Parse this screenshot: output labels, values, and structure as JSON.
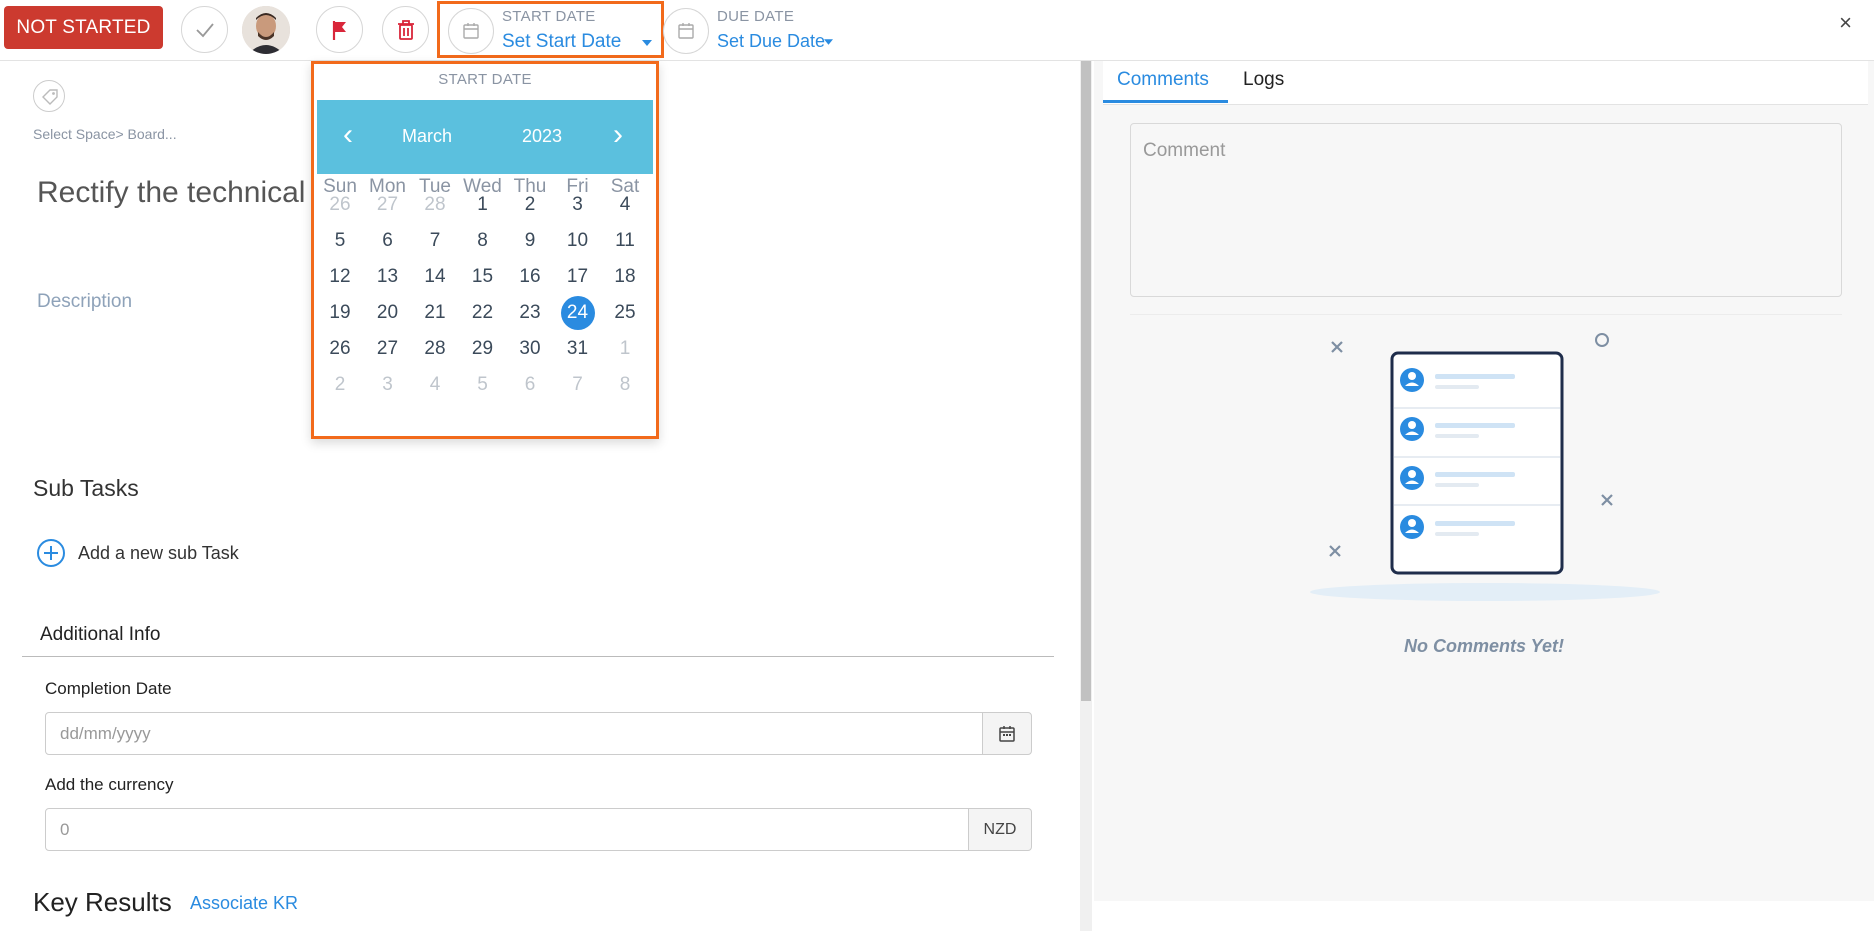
{
  "topbar": {
    "status_label": "NOT STARTED",
    "start_date": {
      "label": "START DATE",
      "value": "Set Start Date"
    },
    "due_date": {
      "label": "DUE DATE",
      "value": "Set Due Date"
    },
    "close_label": "×"
  },
  "left": {
    "breadcrumb": "Select Space> Board...",
    "task_title": "Rectify the technical s",
    "description_label": "Description",
    "subtasks_label": "Sub Tasks",
    "add_subtask_label": "Add a new sub Task",
    "additional_info_label": "Additional Info",
    "completion_date_label": "Completion Date",
    "completion_date_placeholder": "dd/mm/yyyy",
    "currency_label": "Add the currency",
    "currency_placeholder": "0",
    "currency_code": "NZD",
    "key_results_label": "Key Results",
    "associate_kr_label": "Associate KR"
  },
  "right": {
    "tabs": [
      {
        "label": "Comments"
      },
      {
        "label": "Logs"
      }
    ],
    "comment_placeholder": "Comment",
    "empty_message": "No Comments Yet!"
  },
  "calendar": {
    "title": "START DATE",
    "month": "March",
    "year": "2023",
    "prev": "‹",
    "next": "›",
    "weekdays": [
      "Sun",
      "Mon",
      "Tue",
      "Wed",
      "Thu",
      "Fri",
      "Sat"
    ],
    "weeks": [
      [
        "26",
        "27",
        "28",
        "1",
        "2",
        "3",
        "4"
      ],
      [
        "5",
        "6",
        "7",
        "8",
        "9",
        "10",
        "11"
      ],
      [
        "12",
        "13",
        "14",
        "15",
        "16",
        "17",
        "18"
      ],
      [
        "19",
        "20",
        "21",
        "22",
        "23",
        "24",
        "25"
      ],
      [
        "26",
        "27",
        "28",
        "29",
        "30",
        "31",
        "1"
      ],
      [
        "2",
        "3",
        "4",
        "5",
        "6",
        "7",
        "8"
      ]
    ],
    "muted_days": [
      [
        0,
        0
      ],
      [
        0,
        1
      ],
      [
        0,
        2
      ],
      [
        4,
        6
      ],
      [
        5,
        0
      ],
      [
        5,
        1
      ],
      [
        5,
        2
      ],
      [
        5,
        3
      ],
      [
        5,
        4
      ],
      [
        5,
        5
      ],
      [
        5,
        6
      ]
    ],
    "selected_day": [
      3,
      5
    ]
  },
  "colors": {
    "status": "#cc3a2f",
    "accent": "#2a8be0",
    "highlight": "#f26a1b",
    "calendar_header": "#5bc0de"
  }
}
